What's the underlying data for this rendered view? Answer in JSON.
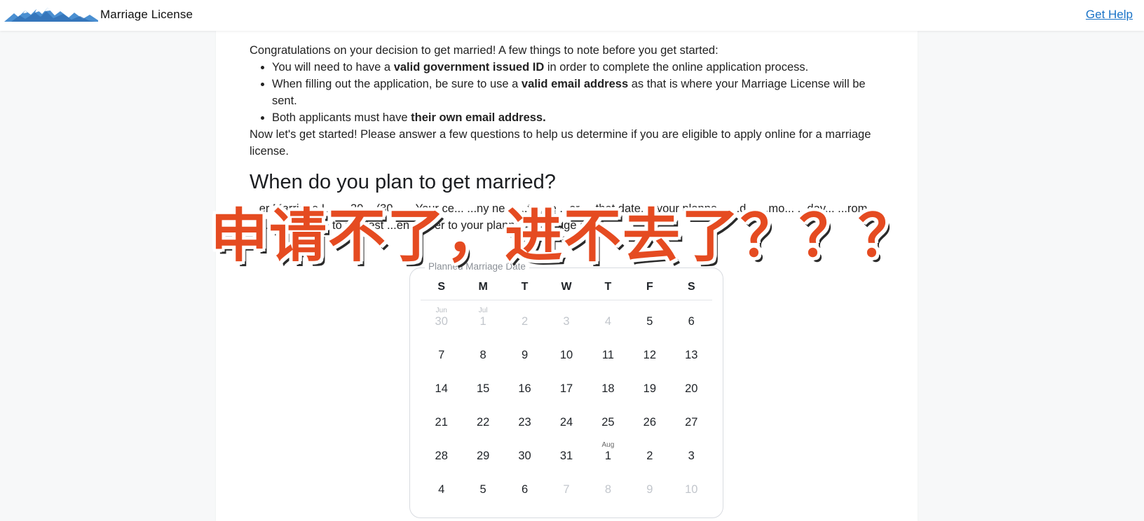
{
  "header": {
    "app_title": "Marriage License",
    "logo_icon": "mountains-logo-icon",
    "help_link": "Get Help"
  },
  "intro": {
    "lead": "Congratulations on your decision to get married! A few things to note before you get started:",
    "bullets": [
      {
        "pre": "You will need to have a ",
        "bold": "valid government issued ID",
        "post": " in order to complete the online application process."
      },
      {
        "pre": "When filling out the application, be sure to use a ",
        "bold": "valid email address",
        "post": " as that is where your Marriage License will be sent."
      },
      {
        "pre": "Both applicants must have ",
        "bold": "their own email address.",
        "post": ""
      }
    ],
    "outro": "Now let's get started! Please answer a few questions to help us determine if you are eligible to apply online for a marriage license."
  },
  "section": {
    "heading": "When do you plan to get married?",
    "note_part1": "...er Marriage L... ...30 ...(30... ...Your ce... ...ny ne... ...to ...e ...or ... that date. If your planne... ...d... ...mo... ...day... ...rom to...y, ",
    "note_link": "click here",
    "note_part2": " to request ...en ...oser to your planned marriage date."
  },
  "date_picker": {
    "legend": "Planned Marriage Date",
    "weekdays": [
      "S",
      "M",
      "T",
      "W",
      "T",
      "F",
      "S"
    ],
    "weeks": [
      [
        {
          "d": "30",
          "m": "Jun",
          "off": true
        },
        {
          "d": "1",
          "m": "Jul",
          "off": true
        },
        {
          "d": "2",
          "off": true
        },
        {
          "d": "3",
          "off": true
        },
        {
          "d": "4",
          "off": true
        },
        {
          "d": "5"
        },
        {
          "d": "6"
        }
      ],
      [
        {
          "d": "7"
        },
        {
          "d": "8"
        },
        {
          "d": "9"
        },
        {
          "d": "10"
        },
        {
          "d": "11"
        },
        {
          "d": "12"
        },
        {
          "d": "13"
        }
      ],
      [
        {
          "d": "14"
        },
        {
          "d": "15"
        },
        {
          "d": "16"
        },
        {
          "d": "17"
        },
        {
          "d": "18"
        },
        {
          "d": "19"
        },
        {
          "d": "20"
        }
      ],
      [
        {
          "d": "21"
        },
        {
          "d": "22"
        },
        {
          "d": "23"
        },
        {
          "d": "24"
        },
        {
          "d": "25"
        },
        {
          "d": "26"
        },
        {
          "d": "27"
        }
      ],
      [
        {
          "d": "28"
        },
        {
          "d": "29"
        },
        {
          "d": "30"
        },
        {
          "d": "31"
        },
        {
          "d": "1",
          "m": "Aug"
        },
        {
          "d": "2"
        },
        {
          "d": "3"
        }
      ],
      [
        {
          "d": "4"
        },
        {
          "d": "5"
        },
        {
          "d": "6"
        },
        {
          "d": "7",
          "off": true
        },
        {
          "d": "8",
          "off": true
        },
        {
          "d": "9",
          "off": true
        },
        {
          "d": "10",
          "off": true
        }
      ]
    ]
  },
  "overlay": {
    "caption": "申请不了，进不去了？？？"
  },
  "colors": {
    "link": "#1a73c7",
    "overlay_text": "#e54b21",
    "disabled_day": "#c2c6cc"
  }
}
